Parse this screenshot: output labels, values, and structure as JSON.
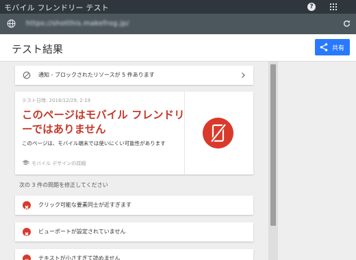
{
  "window": {
    "title": "モバイル フレンドリー テスト",
    "help_icon": "help-icon",
    "apps_icon": "apps-grid-icon",
    "header_color": "#2f373c"
  },
  "address_bar": {
    "url": "https://shotthis.makefrog.jp/",
    "globe_icon": "globe-icon",
    "reload_icon": "reload-icon"
  },
  "header": {
    "title": "テスト結果",
    "share_label": "共有",
    "accent": "#2979ff"
  },
  "blocked_resources": {
    "text": "通知 - ブロックされたリソースが 5 件あります"
  },
  "result": {
    "test_date": "テスト日時: 2016/12/29, 2:19",
    "headline": "このページはモバイル フレンドリーではありません",
    "description": "このページは、モバイル端末では使いにくい可能性があります",
    "design_link": "モバイル デザインの詳細",
    "status_color": "#c53929"
  },
  "fix_note": "次の 3 件の問題を修正してください",
  "issues": [
    {
      "label": "クリック可能な要素同士が近すぎます"
    },
    {
      "label": "ビューポートが設定されていません"
    },
    {
      "label": "テキストが小さすぎて読めません"
    }
  ]
}
